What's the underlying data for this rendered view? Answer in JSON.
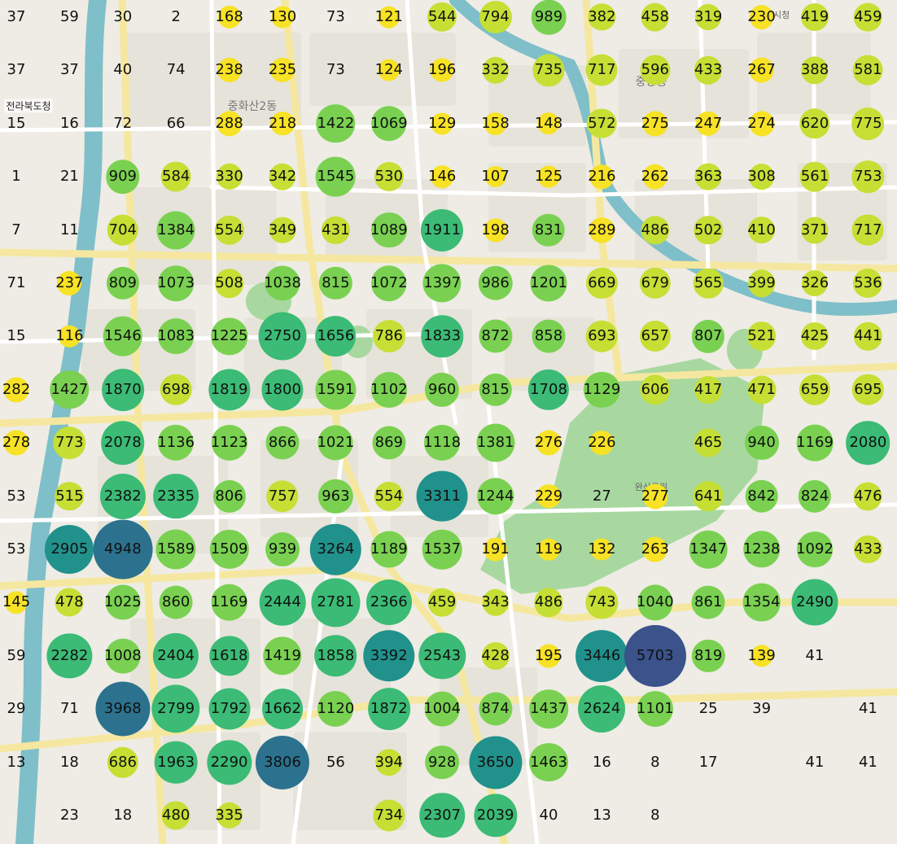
{
  "map": {
    "places": [
      {
        "id": "jeonbuk-provincial-office",
        "label": "전라북도청"
      },
      {
        "id": "hwasan-2dong",
        "label": "중화산2동"
      },
      {
        "id": "jungang-dong",
        "label": "중앙동"
      },
      {
        "id": "wansan-park",
        "label": "완산공원"
      },
      {
        "id": "jeonju-sin-si",
        "label": "전주시청"
      }
    ],
    "grid": {
      "cols": 17,
      "rows": 16,
      "counts": [
        [
          37,
          59,
          30,
          2,
          168,
          130,
          73,
          121,
          544,
          794,
          989,
          382,
          458,
          319,
          230,
          419,
          459
        ],
        [
          37,
          37,
          40,
          74,
          238,
          235,
          73,
          124,
          196,
          332,
          735,
          717,
          596,
          433,
          267,
          388,
          581
        ],
        [
          15,
          16,
          72,
          66,
          288,
          218,
          1422,
          1069,
          129,
          158,
          148,
          572,
          275,
          247,
          274,
          620,
          775
        ],
        [
          1,
          21,
          909,
          584,
          330,
          342,
          1545,
          530,
          146,
          107,
          125,
          216,
          262,
          363,
          308,
          561,
          753
        ],
        [
          7,
          11,
          704,
          1384,
          554,
          349,
          431,
          1089,
          1911,
          198,
          831,
          289,
          486,
          502,
          410,
          371,
          717
        ],
        [
          71,
          237,
          809,
          1073,
          508,
          1038,
          815,
          1072,
          1397,
          986,
          1201,
          669,
          679,
          565,
          399,
          326,
          536
        ],
        [
          15,
          116,
          1546,
          1083,
          1225,
          2750,
          1656,
          786,
          1833,
          872,
          858,
          693,
          657,
          807,
          521,
          425,
          441
        ],
        [
          282,
          1427,
          1870,
          698,
          1819,
          1800,
          1591,
          1102,
          960,
          815,
          1708,
          1129,
          606,
          417,
          471,
          659,
          695
        ],
        [
          278,
          773,
          2078,
          1136,
          1123,
          866,
          1021,
          869,
          1118,
          1381,
          276,
          226,
          null,
          465,
          940,
          1169,
          2080
        ],
        [
          53,
          515,
          2382,
          2335,
          806,
          757,
          963,
          554,
          3311,
          1244,
          229,
          27,
          277,
          641,
          842,
          824,
          476
        ],
        [
          53,
          2905,
          4948,
          1589,
          1509,
          939,
          3264,
          1189,
          1537,
          191,
          119,
          132,
          263,
          1347,
          1238,
          1092,
          433
        ],
        [
          145,
          478,
          1025,
          860,
          1169,
          2444,
          2781,
          2366,
          459,
          343,
          486,
          743,
          1040,
          861,
          1354,
          2490,
          null
        ],
        [
          59,
          2282,
          1008,
          2404,
          1618,
          1419,
          1858,
          3392,
          2543,
          428,
          195,
          3446,
          5703,
          819,
          139,
          41,
          null
        ],
        [
          29,
          71,
          3968,
          2799,
          1792,
          1662,
          1120,
          1872,
          1004,
          874,
          1437,
          2624,
          1101,
          25,
          39,
          null,
          41
        ],
        [
          13,
          18,
          686,
          1963,
          2290,
          3806,
          56,
          394,
          928,
          3650,
          1463,
          16,
          8,
          17,
          null,
          41,
          41
        ],
        [
          null,
          23,
          18,
          480,
          335,
          null,
          null,
          734,
          2307,
          2039,
          40,
          13,
          8,
          null,
          null,
          null,
          null
        ]
      ]
    },
    "colors": {
      "background": "#eeece4",
      "park": "#a8d8a0",
      "river": "#7fbfc9",
      "road_major": "#f6e7a0",
      "road_minor": "#ffffff",
      "scale": [
        "#f7e225",
        "#c5df34",
        "#7ad151",
        "#3bbb75",
        "#21918c",
        "#2c728e",
        "#3b528b"
      ]
    }
  }
}
